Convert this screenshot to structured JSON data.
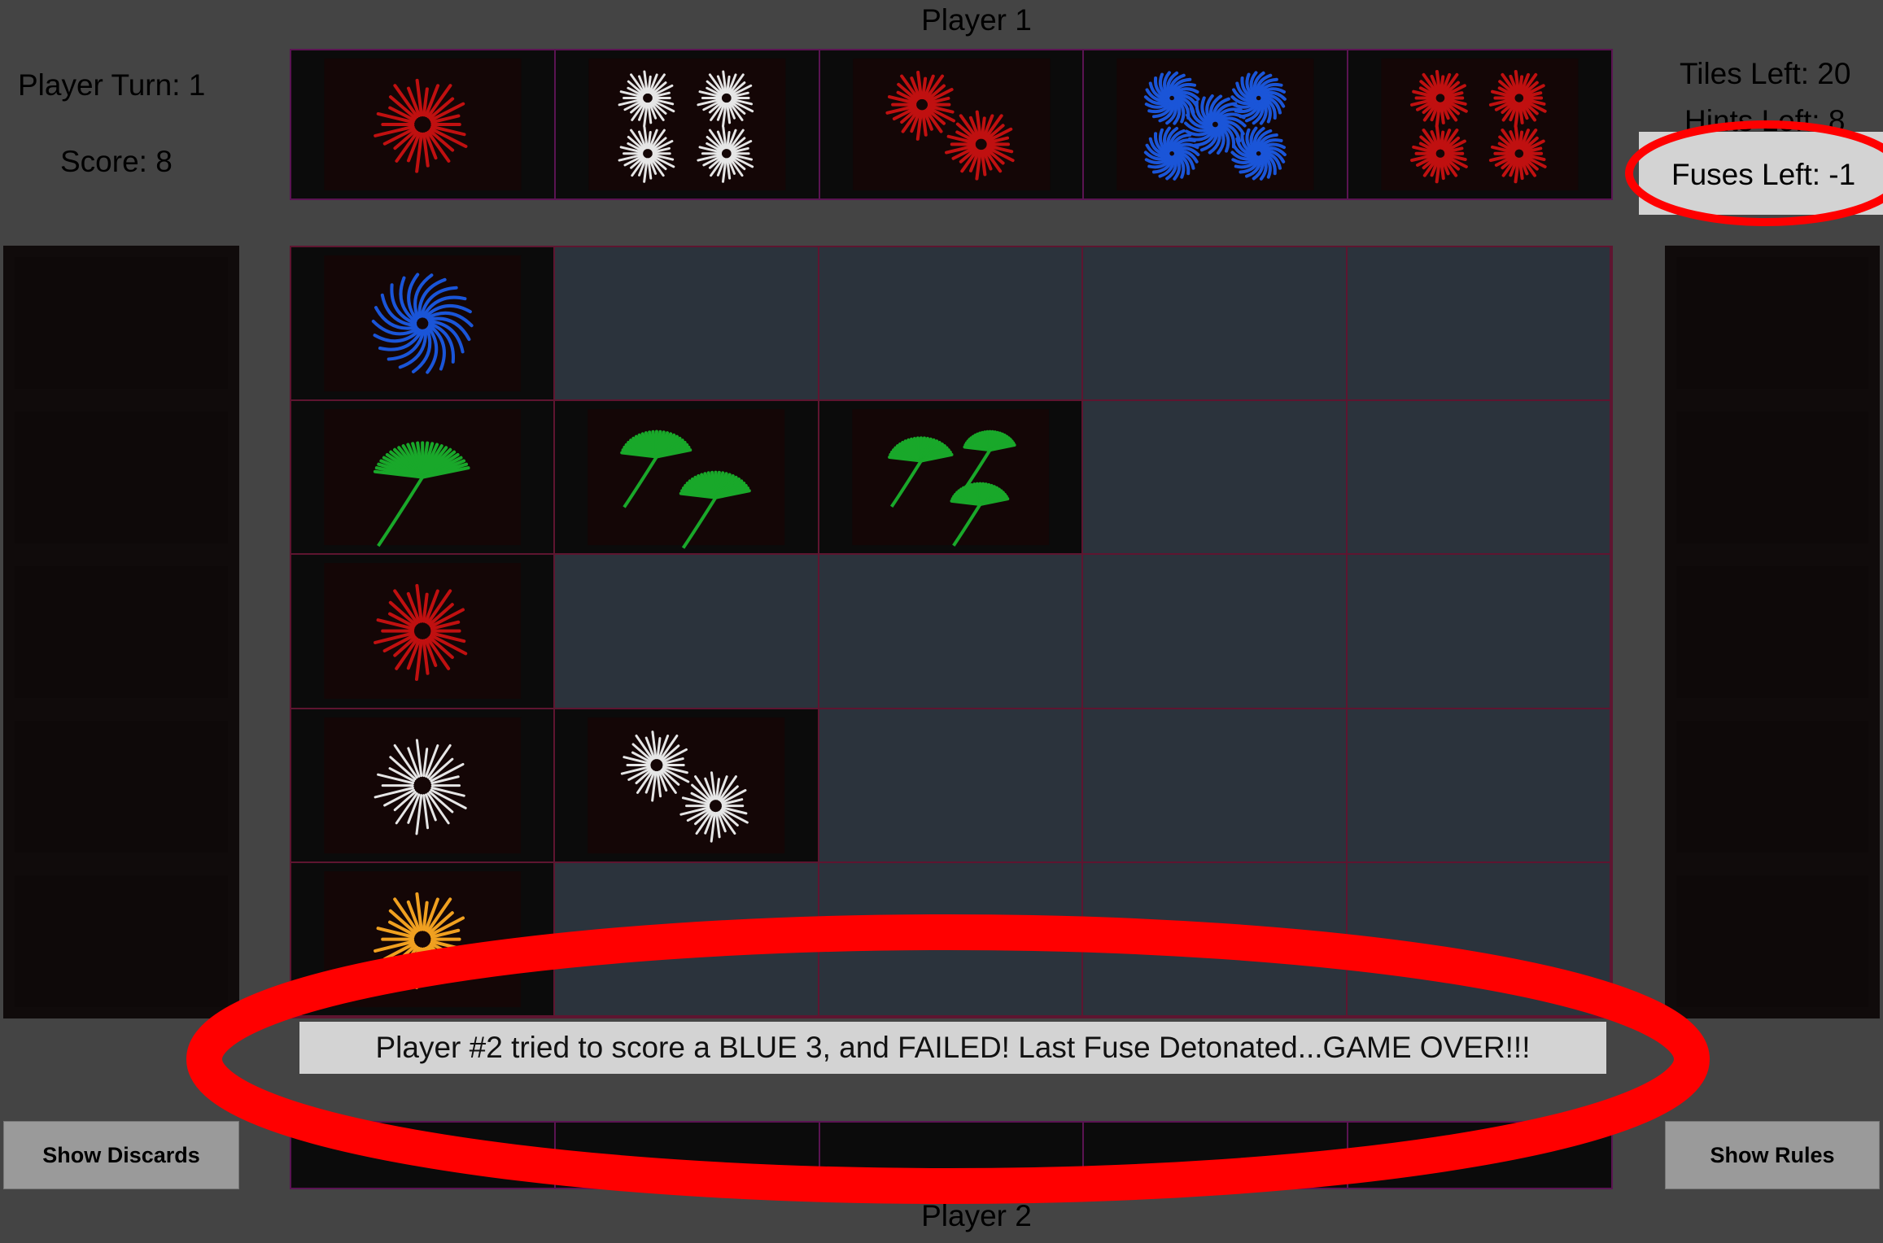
{
  "header": {
    "player_top": "Player 1",
    "player_bottom": "Player 2"
  },
  "stats": {
    "player_turn": "Player Turn: 1",
    "score": "Score: 8",
    "tiles_left": "Tiles Left: 20",
    "hints_left": "Hints Left: 8",
    "fuses_left": "Fuses Left: -1"
  },
  "player1_hand": [
    {
      "color": "red",
      "count": 1
    },
    {
      "color": "white",
      "count": 4
    },
    {
      "color": "red",
      "count": 2
    },
    {
      "color": "blue",
      "count": 5
    },
    {
      "color": "red",
      "count": 4
    }
  ],
  "board": {
    "rows": [
      {
        "color": "blue",
        "played": 1
      },
      {
        "color": "green",
        "played": 3
      },
      {
        "color": "red",
        "played": 1
      },
      {
        "color": "white",
        "played": 2
      },
      {
        "color": "yellow",
        "played": 1
      }
    ],
    "columns": 5
  },
  "colors": {
    "red": "#c01010",
    "white": "#e6e6e6",
    "blue": "#1a55d8",
    "green": "#19a82a",
    "yellow": "#f0a020",
    "background": "#444444",
    "board_empty": "#2b333c",
    "annotation": "#ff0000"
  },
  "status_message": "Player #2 tried to score a BLUE 3, and FAILED! Last Fuse Detonated...GAME OVER!!!",
  "buttons": {
    "show_discards": "Show Discards",
    "show_rules": "Show Rules"
  }
}
